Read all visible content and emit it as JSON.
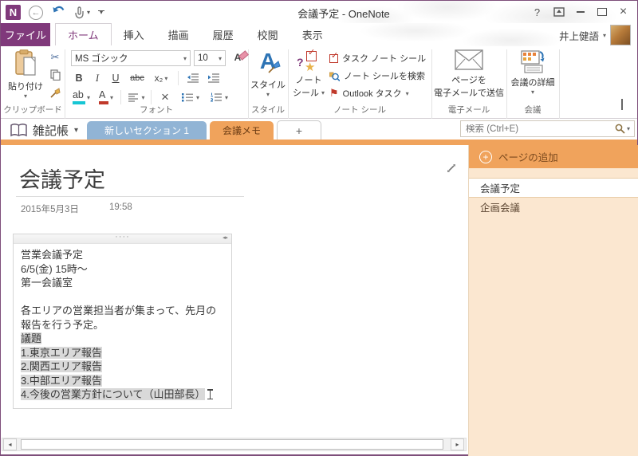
{
  "titlebar": {
    "title": "会議予定 - OneNote"
  },
  "tabs": {
    "file": "ファイル",
    "items": [
      "ホーム",
      "挿入",
      "描画",
      "履歴",
      "校閲",
      "表示"
    ],
    "user_name": "井上健語"
  },
  "ribbon": {
    "clipboard": {
      "paste": "貼り付け",
      "label": "クリップボード"
    },
    "font": {
      "family": "MS ゴシック",
      "size": "10",
      "label": "フォント"
    },
    "styles": {
      "button": "スタイル",
      "label": "スタイル"
    },
    "tags": {
      "button_line1": "ノート",
      "button_line2": "シール",
      "task": "タスク ノート シール",
      "search": "ノート シールを検索",
      "outlook": "Outlook タスク",
      "label": "ノート シール"
    },
    "email": {
      "line1": "ページを",
      "line2": "電子メールで送信",
      "label": "電子メール"
    },
    "meeting": {
      "button": "会議の詳細",
      "label": "会議"
    }
  },
  "notebook_bar": {
    "notebook": "雑記帳",
    "sections": [
      "新しいセクション 1",
      "会議メモ"
    ],
    "new_section": "+",
    "search_placeholder": "検索 (Ctrl+E)"
  },
  "page": {
    "title": "会議予定",
    "date": "2015年5月3日",
    "time": "19:58",
    "note_lines": [
      "営業会議予定",
      "6/5(金) 15時〜",
      "第一会議室",
      "",
      "各エリアの営業担当者が集まって、先月の",
      "報告を行う予定。",
      "議題",
      "1.東京エリア報告",
      "2.関西エリア報告",
      "3.中部エリア報告",
      "4.今後の営業方針について（山田部長）"
    ]
  },
  "sidebar": {
    "add_page": "ページの追加",
    "pages": [
      "会議予定",
      "企画会議"
    ]
  },
  "icons": {
    "dropdown": "▾",
    "help": "?",
    "close": "×",
    "back_arrow": "←",
    "scissors": "✂",
    "star": "★",
    "flag": "⚑",
    "check": "✓",
    "plus": "+",
    "note_handle_dots": "····",
    "resize_left": "◂",
    "resize_right": "▸",
    "bold": "B",
    "italic": "I",
    "underline": "U",
    "strikethrough": "abc",
    "subscript": "x₂",
    "highlight_ab": "ab",
    "font_color_a": "A",
    "clear_format_a": "A",
    "clear_x": "×",
    "styles_a": "A",
    "question_purple": "?"
  },
  "colors": {
    "brand_purple": "#80397B",
    "section_orange": "#F0A35C",
    "section_blue": "#91B4D5",
    "sidebar_peach": "#FBE7D0",
    "selection_gray": "#D9D9D9"
  }
}
